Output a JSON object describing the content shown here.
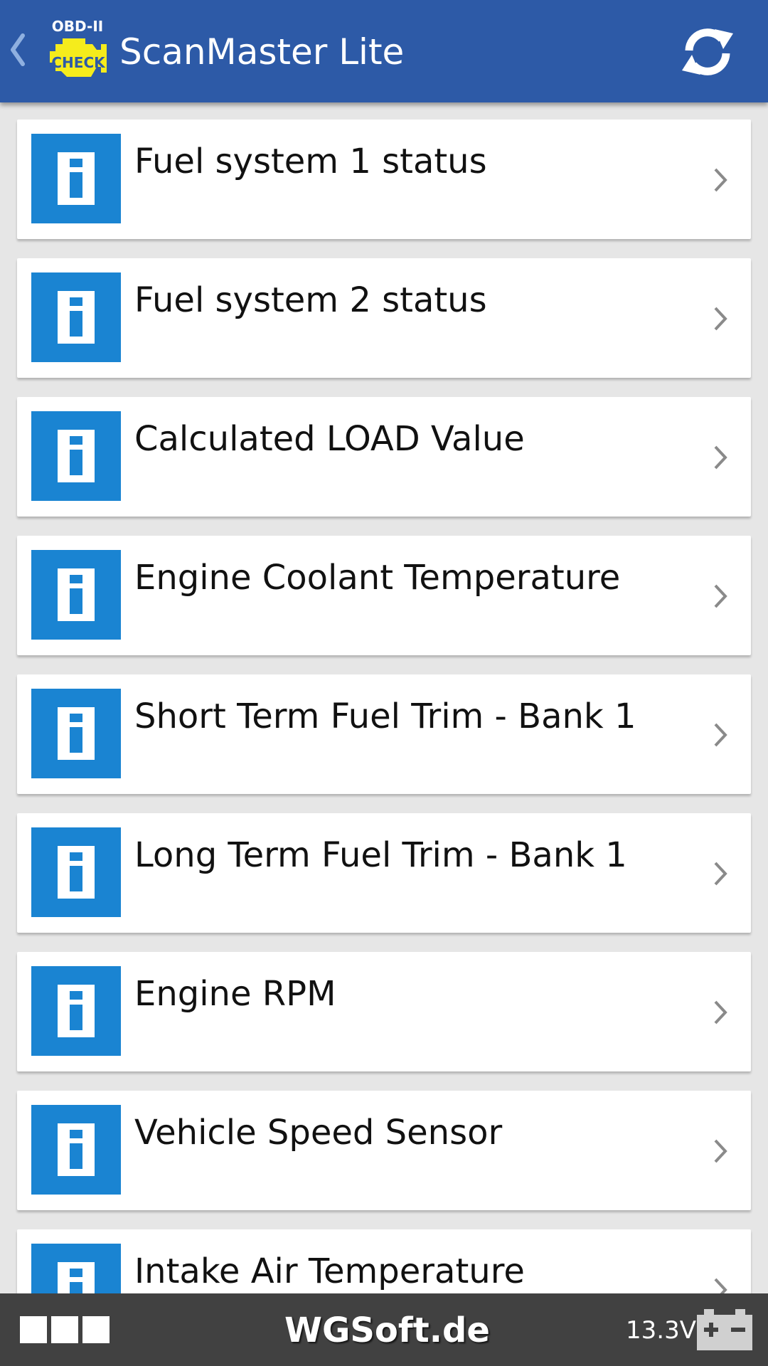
{
  "header": {
    "logo_caption": "OBD-II",
    "logo_word": "CHECK",
    "title": "ScanMaster Lite",
    "icons": {
      "back": "chevron-left-icon",
      "refresh": "refresh-icon"
    }
  },
  "list": {
    "items": [
      {
        "label": "Fuel system 1 status",
        "icon": "info-icon"
      },
      {
        "label": "Fuel system 2 status",
        "icon": "info-icon"
      },
      {
        "label": "Calculated LOAD Value",
        "icon": "info-icon"
      },
      {
        "label": "Engine Coolant Temperature",
        "icon": "info-icon"
      },
      {
        "label": "Short Term Fuel Trim - Bank 1",
        "icon": "info-icon"
      },
      {
        "label": "Long Term Fuel Trim - Bank 1",
        "icon": "info-icon"
      },
      {
        "label": "Engine RPM",
        "icon": "info-icon"
      },
      {
        "label": "Vehicle Speed Sensor",
        "icon": "info-icon"
      },
      {
        "label": "Intake Air Temperature",
        "icon": "info-icon"
      }
    ]
  },
  "footer": {
    "site": "WGSoft.de",
    "voltage": "13.3V",
    "icons": {
      "grid": "grid-icon",
      "battery": "battery-icon"
    }
  },
  "colors": {
    "action_bar": "#2d5aa7",
    "info_icon": "#1a84d2",
    "list_background": "#e6e6e6",
    "bottom_bar": "#414141",
    "logo_yellow": "#f5ec1c"
  }
}
